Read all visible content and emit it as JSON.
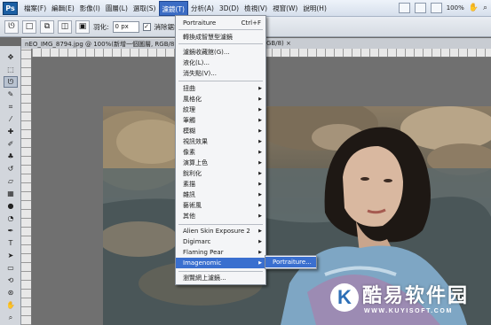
{
  "menubar": {
    "logo": "Ps",
    "items": [
      "檔案(F)",
      "編輯(E)",
      "影像(I)",
      "圖層(L)",
      "選取(S)",
      "濾鏡(T)",
      "分析(A)",
      "3D(D)",
      "檢視(V)",
      "視窗(W)",
      "說明(H)"
    ],
    "zoom": "100%"
  },
  "options": {
    "feather_label": "羽化:",
    "feather_value": "0 px",
    "antialias_label": "消除鋸齒"
  },
  "document_tab": {
    "title": "nEO_IMG_8794.jpg @ 100%(新增一個圖層, RGB/8) ×",
    "title_tail": "GB/8) ×"
  },
  "filter_menu": {
    "items": [
      {
        "label": "Portraiture",
        "shortcut": "Ctrl+F",
        "submenu": false
      },
      {
        "label": "轉換成智慧型濾鏡",
        "submenu": false
      },
      {
        "label": "濾鏡收藏館(G)...",
        "submenu": false
      },
      {
        "label": "液化(L)...",
        "submenu": false
      },
      {
        "label": "消失點(V)...",
        "submenu": false
      },
      {
        "label": "扭曲",
        "submenu": true
      },
      {
        "label": "風格化",
        "submenu": true
      },
      {
        "label": "紋理",
        "submenu": true
      },
      {
        "label": "筆觸",
        "submenu": true
      },
      {
        "label": "模糊",
        "submenu": true
      },
      {
        "label": "視訊效果",
        "submenu": true
      },
      {
        "label": "像素",
        "submenu": true
      },
      {
        "label": "演算上色",
        "submenu": true
      },
      {
        "label": "銳利化",
        "submenu": true
      },
      {
        "label": "素描",
        "submenu": true
      },
      {
        "label": "雜訊",
        "submenu": true
      },
      {
        "label": "藝術風",
        "submenu": true
      },
      {
        "label": "其他",
        "submenu": true
      },
      {
        "label": "Alien Skin Exposure 2",
        "submenu": true
      },
      {
        "label": "Digimarc",
        "submenu": true
      },
      {
        "label": "Flaming Pear",
        "submenu": true
      },
      {
        "label": "Imagenomic",
        "submenu": true
      },
      {
        "label": "瀏覽網上濾鏡...",
        "submenu": false
      }
    ]
  },
  "submenu": {
    "items": [
      "Portraiture..."
    ]
  },
  "watermark": {
    "logo": "K",
    "brand": "酷易软件园",
    "url": "WWW.KUYISOFT.COM"
  },
  "colors": {
    "menu_highlight": "#3a6fcf",
    "watermark_blue": "#2d6fb7"
  }
}
